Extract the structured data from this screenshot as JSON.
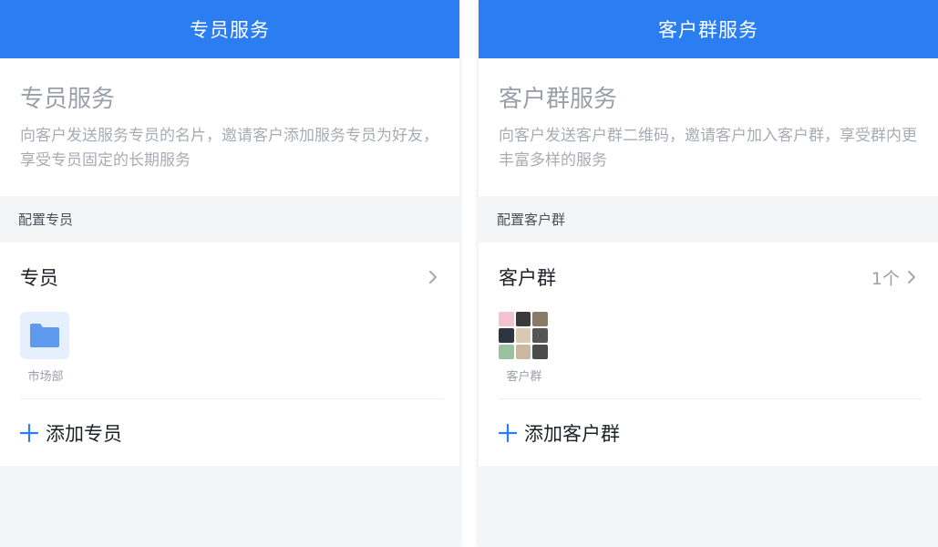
{
  "left": {
    "header_title": "专员服务",
    "intro_title": "专员服务",
    "intro_desc": "向客户发送服务专员的名片，邀请客户添加服务专员为好友，享受专员固定的长期服务",
    "section_label": "配置专员",
    "row_title": "专员",
    "tile_label": "市场部",
    "tile_icon": "folder-icon",
    "add_label": "添加专员"
  },
  "right": {
    "header_title": "客户群服务",
    "intro_title": "客户群服务",
    "intro_desc": "向客户发送客户群二维码，邀请客户加入客户群，享受群内更丰富多样的服务",
    "section_label": "配置客户群",
    "row_title": "客户群",
    "row_count": "1个",
    "tile_label": "客户群",
    "add_label": "添加客户群"
  },
  "colors": {
    "header_bg": "#2b7df2",
    "accent": "#2b7df2",
    "folder": "#5e9bef",
    "page_bg": "#f4f5f7"
  }
}
